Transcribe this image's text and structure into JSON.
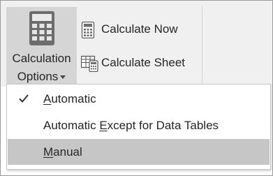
{
  "ribbon": {
    "calc_options": {
      "line1": "Calculation",
      "line2": "Options",
      "icon": "calculator-icon"
    },
    "calculate_now": {
      "label": "Calculate Now",
      "icon": "calculator-small-icon"
    },
    "calculate_sheet": {
      "label": "Calculate Sheet",
      "icon": "calculate-sheet-icon"
    }
  },
  "menu": {
    "items": [
      {
        "label": "Automatic",
        "checked": true,
        "underline_index": 0
      },
      {
        "label": "Automatic Except for Data Tables",
        "checked": false,
        "underline_index": 10
      },
      {
        "label": "Manual",
        "checked": false,
        "underline_index": 0,
        "highlighted": true
      }
    ],
    "check_icon": "checkmark-icon"
  },
  "colors": {
    "ribbon_bg": "#f0f0f0",
    "button_pressed": "#d5d5d5",
    "menu_highlight": "#c6c6c6",
    "text": "#262626"
  }
}
